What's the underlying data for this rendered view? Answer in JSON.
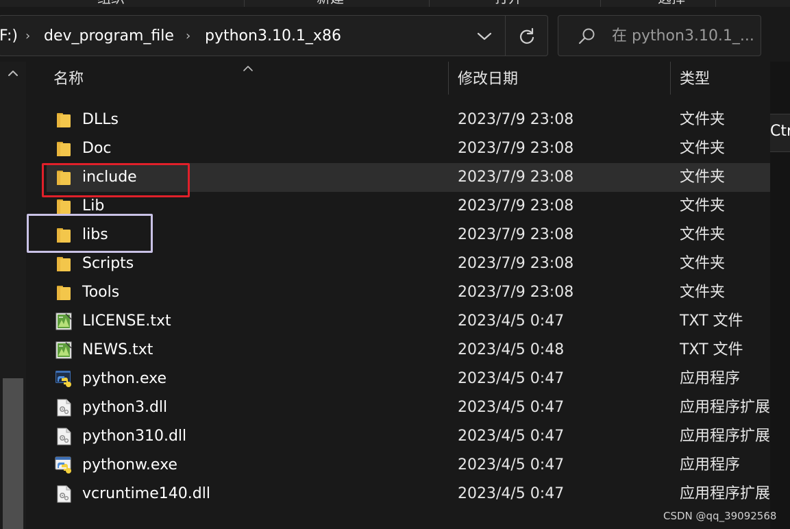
{
  "ribbon": {
    "items": [
      "组织",
      "新建",
      "打开",
      "选择"
    ]
  },
  "address": {
    "crumbs": [
      "F:)",
      "dev_program_file",
      "python3.10.1_x86"
    ]
  },
  "search": {
    "placeholder": "在 python3.10.1_..."
  },
  "columns": {
    "name": "名称",
    "date": "修改日期",
    "type": "类型"
  },
  "rows": [
    {
      "name": "DLLs",
      "date": "2023/7/9 23:08",
      "type": "文件夹",
      "icon": "folder-icon"
    },
    {
      "name": "Doc",
      "date": "2023/7/9 23:08",
      "type": "文件夹",
      "icon": "folder-icon"
    },
    {
      "name": "include",
      "date": "2023/7/9 23:08",
      "type": "文件夹",
      "icon": "folder-icon"
    },
    {
      "name": "Lib",
      "date": "2023/7/9 23:08",
      "type": "文件夹",
      "icon": "folder-icon"
    },
    {
      "name": "libs",
      "date": "2023/7/9 23:08",
      "type": "文件夹",
      "icon": "folder-icon"
    },
    {
      "name": "Scripts",
      "date": "2023/7/9 23:08",
      "type": "文件夹",
      "icon": "folder-icon"
    },
    {
      "name": "Tools",
      "date": "2023/7/9 23:08",
      "type": "文件夹",
      "icon": "folder-icon"
    },
    {
      "name": "LICENSE.txt",
      "date": "2023/4/5 0:47",
      "type": "TXT 文件",
      "icon": "text-file-icon"
    },
    {
      "name": "NEWS.txt",
      "date": "2023/4/5 0:48",
      "type": "TXT 文件",
      "icon": "text-file-icon"
    },
    {
      "name": "python.exe",
      "date": "2023/4/5 0:47",
      "type": "应用程序",
      "icon": "python-exe-icon"
    },
    {
      "name": "python3.dll",
      "date": "2023/4/5 0:47",
      "type": "应用程序扩展",
      "icon": "dll-file-icon"
    },
    {
      "name": "python310.dll",
      "date": "2023/4/5 0:47",
      "type": "应用程序扩展",
      "icon": "dll-file-icon"
    },
    {
      "name": "pythonw.exe",
      "date": "2023/4/5 0:47",
      "type": "应用程序",
      "icon": "pythonw-exe-icon"
    },
    {
      "name": "vcruntime140.dll",
      "date": "2023/4/5 0:47",
      "type": "应用程序扩展",
      "icon": "dll-file-icon"
    }
  ],
  "selected_row": 2,
  "side_tab": {
    "text": "Ctr"
  },
  "watermark": "CSDN @qq_39092568",
  "colors": {
    "background": "#191919",
    "selected_row": "#2e2e2e",
    "highlight_red": "#e0202a",
    "highlight_lavender": "#c9c2e6",
    "folder": "#f3c64b"
  }
}
